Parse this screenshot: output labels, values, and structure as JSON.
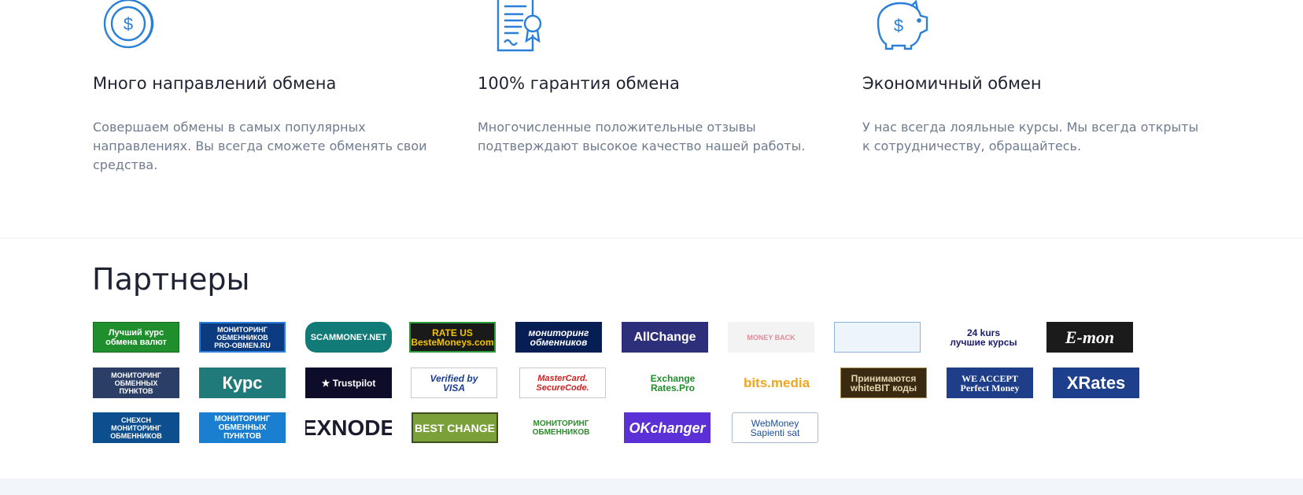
{
  "features": [
    {
      "icon": "dollar-coin-icon",
      "title": "Много направлений обмена",
      "text": "Совершаем обмены в самых популярных направлениях. Вы всегда сможете обменять свои средства."
    },
    {
      "icon": "certificate-icon",
      "title": "100% гарантия обмена",
      "text": "Многочисленные положительные отзывы подтверждают высокое качество нашей работы."
    },
    {
      "icon": "piggy-bank-icon",
      "title": "Экономичный обмен",
      "text": "У нас всегда лояльные курсы. Мы всегда открыты к сотрудничеству, обращайтесь."
    }
  ],
  "partners": {
    "title": "Партнеры",
    "badges": [
      {
        "label": "Лучший курс\nобмена валют",
        "name": "partner-luchshiy-kurs"
      },
      {
        "label": "МОНИТОРИНГ\nОБМЕННИКОВ\nPRO-OBMEN.RU",
        "name": "partner-pro-obmen"
      },
      {
        "label": "SCAMMONEY.NET",
        "name": "partner-scammoney"
      },
      {
        "label": "RATE US\nBesteMoneys.com",
        "name": "partner-bestemoneys"
      },
      {
        "label": "мониторинг\nобменников",
        "name": "partner-monitoring-obmennikov"
      },
      {
        "label": "AllChange",
        "name": "partner-allchange"
      },
      {
        "label": "MONEY BACK",
        "name": "partner-money-back"
      },
      {
        "label": "",
        "name": "partner-icons-grid"
      },
      {
        "label": "24 kurs\nлучшие курсы",
        "name": "partner-24kurs"
      },
      {
        "label": "E-mon",
        "name": "partner-emon"
      },
      {
        "label": "МОНИТОРИНГ\nОБМЕННЫХ\nПУНКТОВ",
        "name": "partner-monitoring-punktov"
      },
      {
        "label": "Курс",
        "name": "partner-kurs"
      },
      {
        "label": "★ Trustpilot",
        "name": "partner-trustpilot"
      },
      {
        "label": "Verified by\nVISA",
        "name": "partner-verified-visa"
      },
      {
        "label": "MasterCard.\nSecureCode.",
        "name": "partner-mastercard-securecode"
      },
      {
        "label": "Exchange\nRates.Pro",
        "name": "partner-exchange-rates-pro"
      },
      {
        "label": "bits.media",
        "name": "partner-bits-media"
      },
      {
        "label": "Принимаются\nwhiteBIT коды",
        "name": "partner-whitebit"
      },
      {
        "label": "WE ACCEPT\nPerfect Money",
        "name": "partner-perfect-money"
      },
      {
        "label": "XRates",
        "name": "partner-xrates"
      },
      {
        "label": "CHEXCH\nМОНИТОРИНГ\nОБМЕННИКОВ",
        "name": "partner-chexch"
      },
      {
        "label": "МОНИТОРИНГ\nОБМЕННЫХ\nПУНКТОВ",
        "name": "partner-monitoring-punktov-2"
      },
      {
        "label": "EXNODE",
        "name": "partner-exnode"
      },
      {
        "label": "BEST CHANGE",
        "name": "partner-bestchange"
      },
      {
        "label": "МОНИТОРИНГ\nОБМЕННИКОВ",
        "name": "partner-monitoring-eye"
      },
      {
        "label": "OKchanger",
        "name": "partner-okchanger"
      },
      {
        "label": "WebMoney\nSapienti sat",
        "name": "partner-webmoney"
      }
    ]
  },
  "colors": {
    "accent": "#2a7fd8",
    "heading": "#1e2233",
    "text": "#6f7b8f",
    "footer_bg": "#f2f5fa"
  }
}
